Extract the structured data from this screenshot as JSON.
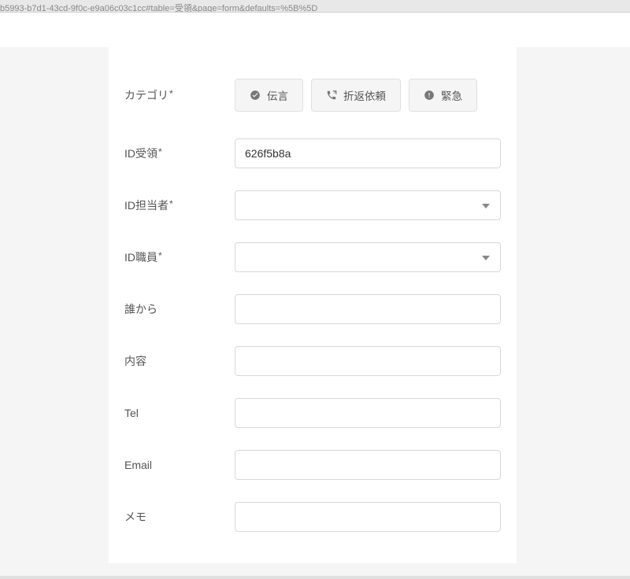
{
  "url_fragment": "b5993-b7d1-43cd-9f0c-e9a06c03c1cc#table=受領&page=form&defaults=%5B%5D",
  "form": {
    "category": {
      "label": "カテゴリ",
      "required_mark": "*",
      "options": [
        {
          "icon": "check-circle",
          "label": "伝言"
        },
        {
          "icon": "phone-callback",
          "label": "折返依頼"
        },
        {
          "icon": "alert-circle",
          "label": "緊急"
        }
      ]
    },
    "id_receipt": {
      "label": "ID受領",
      "required_mark": "*",
      "value": "626f5b8a"
    },
    "id_manager": {
      "label": "ID担当者",
      "required_mark": "*",
      "value": ""
    },
    "id_staff": {
      "label": "ID職員",
      "required_mark": "*",
      "value": ""
    },
    "from_whom": {
      "label": "誰から",
      "value": ""
    },
    "content": {
      "label": "内容",
      "value": ""
    },
    "tel": {
      "label": "Tel",
      "value": ""
    },
    "email": {
      "label": "Email",
      "value": ""
    },
    "memo": {
      "label": "メモ",
      "value": ""
    }
  }
}
